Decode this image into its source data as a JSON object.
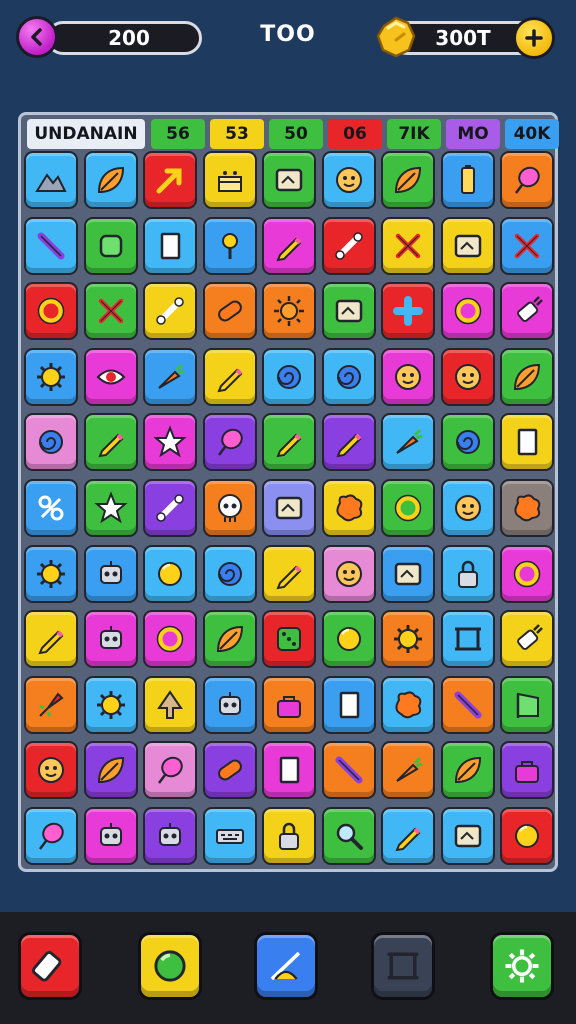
{
  "top_bar": {
    "left_counter": "200",
    "center_label": "TOO",
    "right_counter": "300T",
    "icons": {
      "back": "back-arrow-icon",
      "coin": "gold-nugget-icon",
      "add": "plus-icon"
    }
  },
  "board": {
    "header": {
      "title": "UNDANAIN",
      "cells": [
        {
          "label": "56",
          "color": "#3fbf3f"
        },
        {
          "label": "53",
          "color": "#f5d21a"
        },
        {
          "label": "50",
          "color": "#3fbf3f"
        },
        {
          "label": "06",
          "color": "#e8262a"
        },
        {
          "label": "7IK",
          "color": "#3fbf3f"
        },
        {
          "label": "MO",
          "color": "#a85ce8"
        },
        {
          "label": "40K",
          "color": "#3a9ff0"
        }
      ]
    },
    "rows": [
      [
        {
          "color": "#41b8f5",
          "icon": "mountain"
        },
        {
          "color": "#41b8f5",
          "icon": "leaf"
        },
        {
          "color": "#e8262a",
          "icon": "arrow"
        },
        {
          "color": "#f5d21a",
          "icon": "cake"
        },
        {
          "color": "#3fbf3f",
          "icon": "screen"
        },
        {
          "color": "#41b8f5",
          "icon": "face"
        },
        {
          "color": "#3fbf3f",
          "icon": "leaf"
        },
        {
          "color": "#3a9ff0",
          "icon": "battery"
        },
        {
          "color": "#f57e1e",
          "icon": "balloon"
        }
      ],
      [
        {
          "color": "#41b8f5",
          "icon": "wand"
        },
        {
          "color": "#3fbf3f",
          "icon": "square"
        },
        {
          "color": "#41b8f5",
          "icon": "card"
        },
        {
          "color": "#3a9ff0",
          "icon": "pin"
        },
        {
          "color": "#e83ad6",
          "icon": "pencil"
        },
        {
          "color": "#e8262a",
          "icon": "bone"
        },
        {
          "color": "#f5d21a",
          "icon": "cross"
        },
        {
          "color": "#f5d21a",
          "icon": "screen"
        },
        {
          "color": "#3a9ff0",
          "icon": "cross"
        }
      ],
      [
        {
          "color": "#e8262a",
          "icon": "ring"
        },
        {
          "color": "#3fbf3f",
          "icon": "cross"
        },
        {
          "color": "#f5d21a",
          "icon": "bone"
        },
        {
          "color": "#f57e1e",
          "icon": "pill"
        },
        {
          "color": "#f57e1e",
          "icon": "sun"
        },
        {
          "color": "#3fbf3f",
          "icon": "screen"
        },
        {
          "color": "#e8262a",
          "icon": "plus"
        },
        {
          "color": "#e83ad6",
          "icon": "ring"
        },
        {
          "color": "#e83ad6",
          "icon": "plug"
        }
      ],
      [
        {
          "color": "#3a9ff0",
          "icon": "virus"
        },
        {
          "color": "#e83ad6",
          "icon": "eye"
        },
        {
          "color": "#3a9ff0",
          "icon": "carrot"
        },
        {
          "color": "#f5d21a",
          "icon": "pencil"
        },
        {
          "color": "#41b8f5",
          "icon": "swirl"
        },
        {
          "color": "#41b8f5",
          "icon": "swirl"
        },
        {
          "color": "#e83ad6",
          "icon": "face"
        },
        {
          "color": "#e8262a",
          "icon": "face"
        },
        {
          "color": "#3fbf3f",
          "icon": "leaf"
        }
      ],
      [
        {
          "color": "#e68ad6",
          "icon": "swirl"
        },
        {
          "color": "#3fbf3f",
          "icon": "pencil"
        },
        {
          "color": "#e83ad6",
          "icon": "star"
        },
        {
          "color": "#8a3fe0",
          "icon": "balloon"
        },
        {
          "color": "#3fbf3f",
          "icon": "pencil"
        },
        {
          "color": "#8a3fe0",
          "icon": "pencil"
        },
        {
          "color": "#41b8f5",
          "icon": "carrot"
        },
        {
          "color": "#3fbf3f",
          "icon": "swirl"
        },
        {
          "color": "#f5d21a",
          "icon": "card"
        }
      ],
      [
        {
          "color": "#3a9ff0",
          "icon": "knot"
        },
        {
          "color": "#3fbf3f",
          "icon": "star"
        },
        {
          "color": "#8a3fe0",
          "icon": "bone"
        },
        {
          "color": "#f57e1e",
          "icon": "skull"
        },
        {
          "color": "#8a8ff0",
          "icon": "screen"
        },
        {
          "color": "#f5d21a",
          "icon": "blob"
        },
        {
          "color": "#3fbf3f",
          "icon": "ring"
        },
        {
          "color": "#41b8f5",
          "icon": "face"
        },
        {
          "color": "#8a7f7a",
          "icon": "blob"
        }
      ],
      [
        {
          "color": "#3a9ff0",
          "icon": "virus"
        },
        {
          "color": "#3a9ff0",
          "icon": "robot"
        },
        {
          "color": "#41b8f5",
          "icon": "ball"
        },
        {
          "color": "#41b8f5",
          "icon": "swirl"
        },
        {
          "color": "#f5d21a",
          "icon": "pencil"
        },
        {
          "color": "#e68ad6",
          "icon": "face"
        },
        {
          "color": "#3a9ff0",
          "icon": "screen"
        },
        {
          "color": "#41b8f5",
          "icon": "lock"
        },
        {
          "color": "#e83ad6",
          "icon": "ring"
        }
      ],
      [
        {
          "color": "#f5d21a",
          "icon": "pencil"
        },
        {
          "color": "#e83ad6",
          "icon": "robot"
        },
        {
          "color": "#e83ad6",
          "icon": "ring"
        },
        {
          "color": "#3fbf3f",
          "icon": "leaf"
        },
        {
          "color": "#e8262a",
          "icon": "dice"
        },
        {
          "color": "#3fbf3f",
          "icon": "ball"
        },
        {
          "color": "#f57e1e",
          "icon": "virus"
        },
        {
          "color": "#41b8f5",
          "icon": "frame"
        },
        {
          "color": "#f5d21a",
          "icon": "plug"
        }
      ],
      [
        {
          "color": "#f57e1e",
          "icon": "rocket"
        },
        {
          "color": "#41b8f5",
          "icon": "virus"
        },
        {
          "color": "#f5d21a",
          "icon": "tree"
        },
        {
          "color": "#3a9ff0",
          "icon": "robot"
        },
        {
          "color": "#f57e1e",
          "icon": "bag"
        },
        {
          "color": "#3a9ff0",
          "icon": "card"
        },
        {
          "color": "#41b8f5",
          "icon": "blob"
        },
        {
          "color": "#f57e1e",
          "icon": "wand"
        },
        {
          "color": "#3fbf3f",
          "icon": "flag"
        }
      ],
      [
        {
          "color": "#e8262a",
          "icon": "face"
        },
        {
          "color": "#8a3fe0",
          "icon": "leaf"
        },
        {
          "color": "#e68ad6",
          "icon": "balloon"
        },
        {
          "color": "#8a3fe0",
          "icon": "pill"
        },
        {
          "color": "#e83ad6",
          "icon": "card"
        },
        {
          "color": "#f57e1e",
          "icon": "wand"
        },
        {
          "color": "#f57e1e",
          "icon": "carrot"
        },
        {
          "color": "#3fbf3f",
          "icon": "leaf"
        },
        {
          "color": "#8a3fe0",
          "icon": "bag"
        }
      ],
      [
        {
          "color": "#41b8f5",
          "icon": "balloon"
        },
        {
          "color": "#e83ad6",
          "icon": "robot"
        },
        {
          "color": "#8a3fe0",
          "icon": "robot"
        },
        {
          "color": "#41b8f5",
          "icon": "keyboard"
        },
        {
          "color": "#f5d21a",
          "icon": "lock"
        },
        {
          "color": "#3fbf3f",
          "icon": "magnifier"
        },
        {
          "color": "#41b8f5",
          "icon": "pencil"
        },
        {
          "color": "#41b8f5",
          "icon": "screen"
        },
        {
          "color": "#e8262a",
          "icon": "ball"
        }
      ]
    ]
  },
  "bottom_bar": {
    "tools": [
      {
        "name": "eraser-tool",
        "icon": "eraser",
        "color": "#e8262a"
      },
      {
        "name": "paint-tool",
        "icon": "green-orb",
        "color": "#f5d21a"
      },
      {
        "name": "draw-tool",
        "icon": "draw-slash",
        "color": "#3a7ff0"
      },
      {
        "name": "frame-tool",
        "icon": "frame",
        "color": "#3a4356"
      },
      {
        "name": "settings-tool",
        "icon": "gear",
        "color": "#3fbf3f"
      }
    ]
  }
}
